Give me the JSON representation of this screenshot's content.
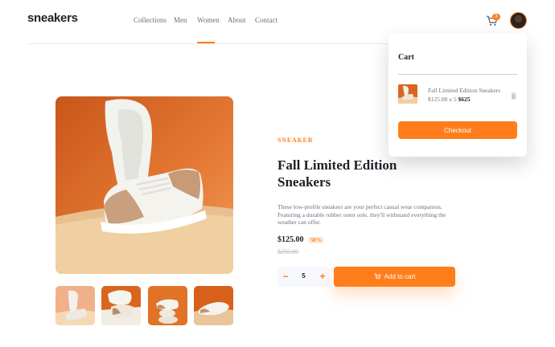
{
  "header": {
    "logo": "sneakers",
    "nav": [
      {
        "label": "Collections"
      },
      {
        "label": "Men"
      },
      {
        "label": "Women"
      },
      {
        "label": "About"
      },
      {
        "label": "Contact"
      }
    ],
    "active_nav": "Women",
    "cart_count": "3",
    "cart_icon": "cart-icon",
    "avatar_icon": "user-avatar"
  },
  "product": {
    "company": "SNEAKER",
    "title": "Fall Limited Edition Sneakers",
    "description": "These low-profile sneakers are your perfect casual wear companion. Featuring a durable rubber outer sole, they'll withstand everything the weather can offer.",
    "price": "$125.00",
    "discount": "50%",
    "old_price": "$250.00",
    "quantity": "5",
    "minus_label": "−",
    "plus_label": "+",
    "add_to_cart_label": "Add to cart"
  },
  "cart": {
    "title": "Cart",
    "item_name": "Fall Limited Edition Sneakers",
    "item_calc": "$125.00 x 5",
    "item_total": "$625",
    "checkout_label": "Checkout",
    "delete_icon": "trash-icon"
  },
  "colors": {
    "accent": "#ff7e1b",
    "accent_pale": "#ffede0",
    "dark": "#1d2026",
    "gray": "#69707d"
  }
}
